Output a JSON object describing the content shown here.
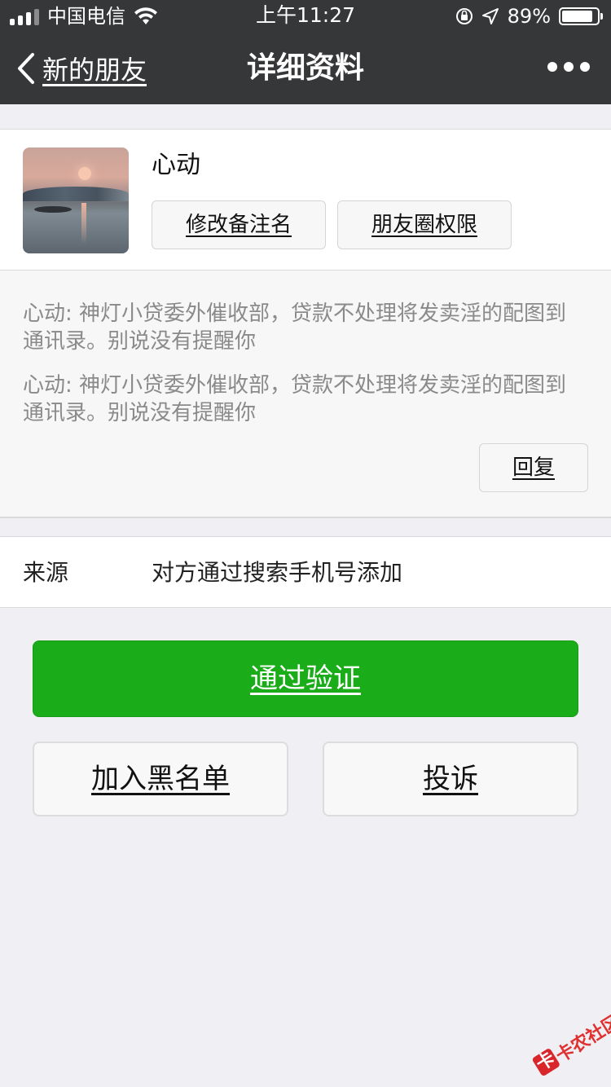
{
  "status_bar": {
    "carrier": "中国电信",
    "time": "上午11:27",
    "battery": "89%",
    "battery_level": 0.89
  },
  "nav": {
    "back_label": "新的朋友",
    "title": "详细资料"
  },
  "profile": {
    "nickname": "心动",
    "edit_remark_label": "修改备注名",
    "moments_permission_label": "朋友圈权限"
  },
  "messages": [
    "心动: 神灯小贷委外催收部，贷款不处理将发卖淫的配图到通讯录。别说没有提醒你",
    "心动: 神灯小贷委外催收部，贷款不处理将发卖淫的配图到通讯录。别说没有提醒你"
  ],
  "reply_label": "回复",
  "source": {
    "label": "来源",
    "value": "对方通过搜索手机号添加"
  },
  "actions": {
    "accept_label": "通过验证",
    "blacklist_label": "加入黑名单",
    "report_label": "投诉"
  },
  "watermark": {
    "badge": "卡",
    "text": "卡农社区"
  },
  "colors": {
    "nav_bg": "#363739",
    "accent_green": "#1aad19",
    "page_bg": "#efeff4"
  }
}
